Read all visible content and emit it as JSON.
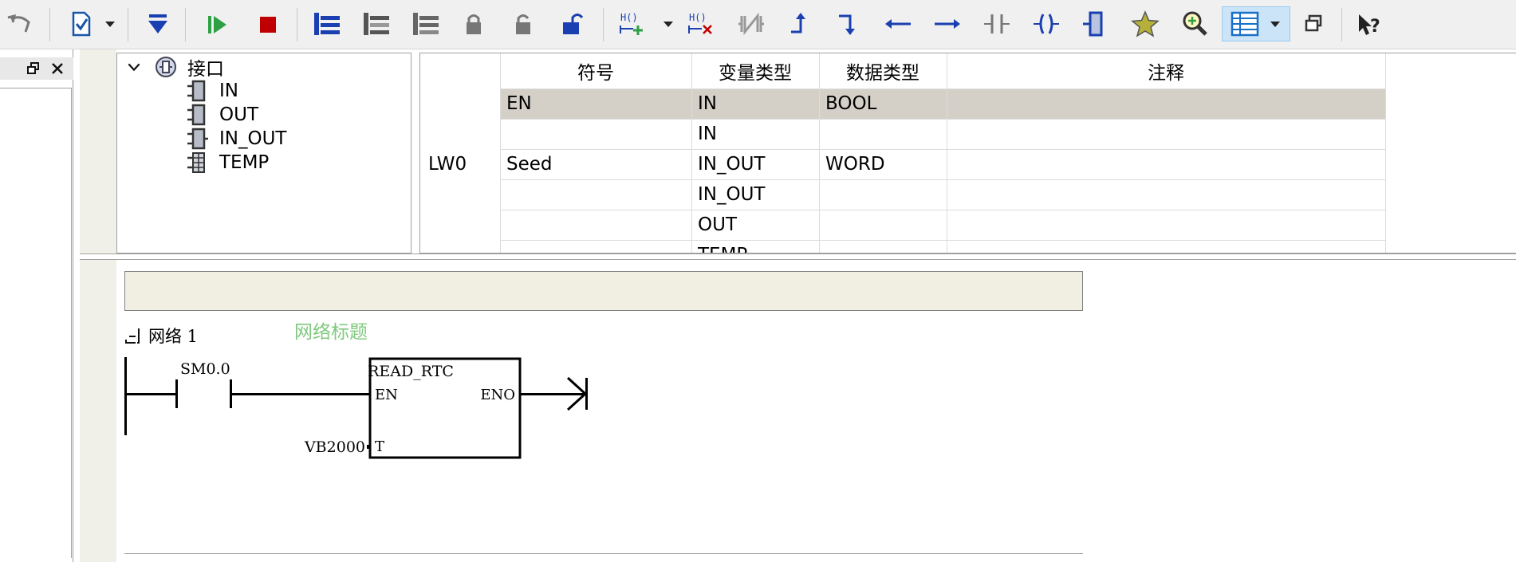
{
  "toolbar": {
    "buttons": [
      "back-icon",
      "new-document-icon",
      "dropdown-arrow-icon",
      "download-icon",
      "run-icon",
      "stop-icon",
      "insert-network-icon",
      "delete-network-icon",
      "network-icon",
      "lock-icon",
      "unlock-icon",
      "unlock-blue-icon",
      "insert-branch-icon",
      "dropdown-arrow-icon",
      "delete-branch-icon",
      "not-contact-icon",
      "arrow-up-icon",
      "arrow-down-icon",
      "arrow-left-icon",
      "arrow-right-icon",
      "contact-icon",
      "coil-icon",
      "box-icon",
      "star-icon",
      "zoom-icon",
      "table-view-icon",
      "dropdown-arrow-icon",
      "window-icon",
      "help-icon"
    ]
  },
  "left_panel": {
    "icons": [
      "restore-window-icon",
      "close-icon"
    ]
  },
  "interface_tree": {
    "root": "接口",
    "items": [
      "IN",
      "OUT",
      "IN_OUT",
      "TEMP"
    ]
  },
  "var_table": {
    "headers": [
      "符号",
      "变量类型",
      "数据类型",
      "注释"
    ],
    "address_label": "LW0",
    "rows": [
      {
        "symbol": "EN",
        "var_type": "IN",
        "data_type": "BOOL",
        "comment": "",
        "selected": true
      },
      {
        "symbol": "",
        "var_type": "IN",
        "data_type": "",
        "comment": ""
      },
      {
        "symbol": "Seed",
        "var_type": "IN_OUT",
        "data_type": "WORD",
        "comment": ""
      },
      {
        "symbol": "",
        "var_type": "IN_OUT",
        "data_type": "",
        "comment": ""
      },
      {
        "symbol": "",
        "var_type": "OUT",
        "data_type": "",
        "comment": ""
      },
      {
        "symbol": "",
        "var_type": "TEMP",
        "data_type": "",
        "comment": ""
      }
    ],
    "selected_row_color": "#d4d0c8"
  },
  "ladder": {
    "network_label": "网络 1",
    "network_title": "网络标题",
    "network_title_color": "#7fc97f",
    "contact_label": "SM0.0",
    "box_title": "READ_RTC",
    "box_in": "EN",
    "box_out": "ENO",
    "box_param": "T",
    "param_value": "VB2000"
  }
}
